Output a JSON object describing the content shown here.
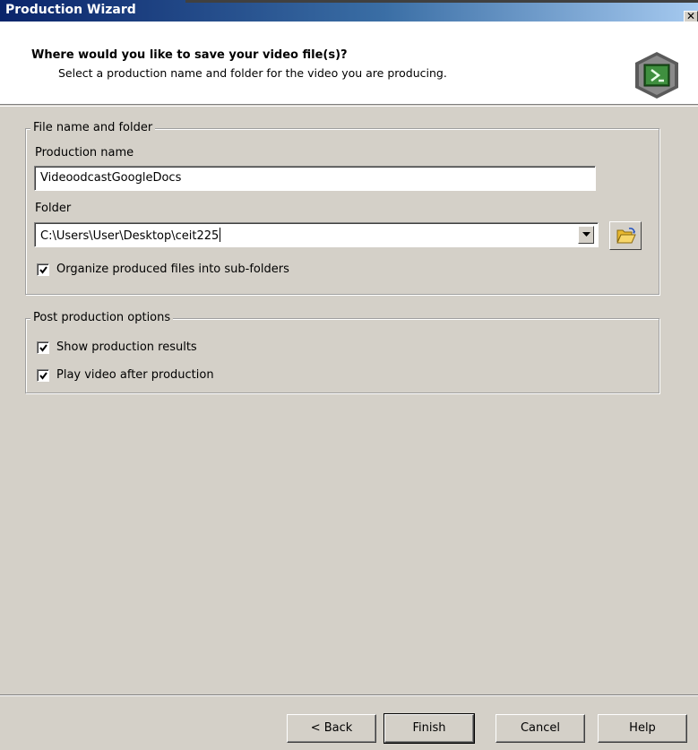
{
  "window": {
    "title": "Production Wizard",
    "close_glyph": "✕"
  },
  "header": {
    "title": "Where would you like to save your video file(s)?",
    "subtitle": "Select a production name and folder for the video you are producing.",
    "logo_icon": "camtasia-logo-icon"
  },
  "file_group": {
    "legend": "File name and folder",
    "production_name_label": "Production name",
    "production_name_value": "VideoodcastGoogleDocs",
    "folder_label": "Folder",
    "folder_value": "C:\\Users\\User\\Desktop\\ceit225",
    "organize_label": "Organize produced files into sub-folders",
    "organize_checked": true
  },
  "post_group": {
    "legend": "Post production options",
    "show_results_label": "Show production results",
    "show_results_checked": true,
    "play_video_label": "Play video after production",
    "play_video_checked": true
  },
  "buttons": {
    "back": "< Back",
    "finish": "Finish",
    "cancel": "Cancel",
    "help": "Help"
  },
  "colors": {
    "titlebar_start": "#0a246a",
    "titlebar_end": "#a6caf0",
    "dialog_bg": "#d4d0c8",
    "header_bg": "#ffffff"
  }
}
